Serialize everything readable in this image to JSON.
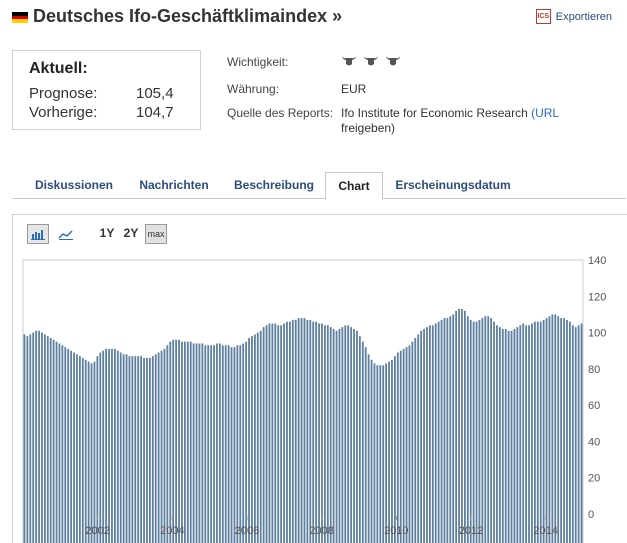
{
  "header": {
    "title": "Deutsches Ifo-Geschäftklimaindex »",
    "export_label": "Exportieren",
    "export_icon": "ics-file-icon",
    "flag_icon": "germany-flag-icon"
  },
  "current": {
    "heading": "Aktuell:",
    "rows": [
      {
        "label": "Prognose:",
        "value": "105,4"
      },
      {
        "label": "Vorherige:",
        "value": "104,7"
      }
    ]
  },
  "info": {
    "importance_label": "Wichtigkeit:",
    "importance_icons": [
      "bull-icon",
      "bull-icon",
      "bull-icon"
    ],
    "currency_label": "Währung:",
    "currency_value": "EUR",
    "source_label": "Quelle des Reports:",
    "source_value": "Ifo Institute for Economic Research",
    "source_link_1": "(URL",
    "source_link_2": "freigeben)"
  },
  "tabs": [
    {
      "label": "Diskussionen",
      "active": false
    },
    {
      "label": "Nachrichten",
      "active": false
    },
    {
      "label": "Beschreibung",
      "active": false
    },
    {
      "label": "Chart",
      "active": true
    },
    {
      "label": "Erscheinungsdatum",
      "active": false
    }
  ],
  "toolbar": {
    "bar_icon": "bar-chart-icon",
    "line_icon": "line-chart-icon",
    "range_1y": "1Y",
    "range_2y": "2Y",
    "range_max": "max"
  },
  "colors": {
    "bar": "#5f7f9f",
    "link": "#2a6ebb",
    "tab_text": "#2a4d7c"
  },
  "chart_data": {
    "type": "bar",
    "title": "",
    "xlabel": "",
    "ylabel": "",
    "x_start": 2000.0,
    "x_end": 2015.0,
    "ylim": [
      0,
      140
    ],
    "yticks": [
      0,
      20,
      40,
      60,
      80,
      100,
      120,
      140
    ],
    "xticks": [
      2002,
      2004,
      2006,
      2008,
      2010,
      2012,
      2014
    ],
    "y_axis_side": "right",
    "grid": false,
    "series": [
      {
        "values": [
          99,
          98,
          99,
          100,
          101,
          101,
          100,
          99,
          98,
          97,
          96,
          95,
          94,
          93,
          92,
          91,
          90,
          89,
          88,
          87,
          86,
          85,
          84,
          83,
          84,
          87,
          89,
          90,
          91,
          91,
          91,
          91,
          90,
          89,
          88,
          88,
          87,
          87,
          87,
          87,
          87,
          86,
          86,
          86,
          87,
          88,
          89,
          90,
          91,
          93,
          95,
          96,
          96,
          96,
          95,
          95,
          95,
          95,
          94,
          94,
          94,
          94,
          93,
          93,
          93,
          93,
          94,
          94,
          93,
          93,
          93,
          92,
          92,
          93,
          93,
          94,
          95,
          97,
          98,
          99,
          100,
          101,
          103,
          104,
          105,
          105,
          105,
          104,
          104,
          105,
          106,
          106,
          107,
          107,
          108,
          108,
          108,
          107,
          107,
          106,
          106,
          105,
          105,
          104,
          104,
          103,
          102,
          101,
          102,
          103,
          104,
          104,
          103,
          102,
          101,
          98,
          95,
          92,
          88,
          85,
          83,
          82,
          82,
          82,
          83,
          84,
          85,
          87,
          89,
          90,
          91,
          92,
          93,
          95,
          97,
          99,
          101,
          102,
          103,
          104,
          104,
          105,
          106,
          107,
          108,
          108,
          109,
          110,
          112,
          113,
          113,
          112,
          109,
          107,
          106,
          106,
          107,
          108,
          109,
          109,
          108,
          106,
          104,
          103,
          102,
          102,
          101,
          101,
          102,
          103,
          104,
          105,
          104,
          104,
          105,
          106,
          106,
          106,
          107,
          108,
          109,
          110,
          110,
          109,
          108,
          108,
          107,
          106,
          104,
          103,
          104,
          105
        ]
      }
    ]
  }
}
